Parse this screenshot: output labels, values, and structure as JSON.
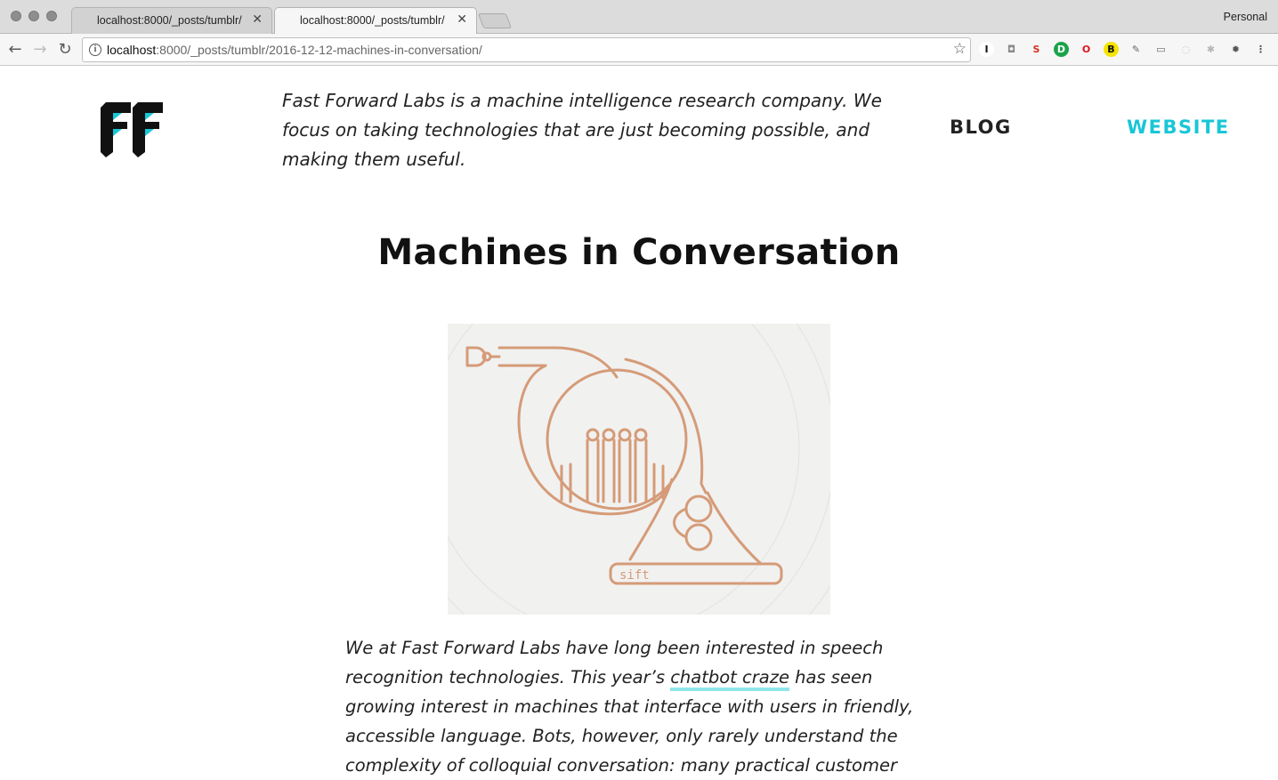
{
  "browser": {
    "tabs": [
      {
        "label": "localhost:8000/_posts/tumblr/",
        "active": false
      },
      {
        "label": "localhost:8000/_posts/tumblr/",
        "active": true
      }
    ],
    "profile": "Personal",
    "url_host": "localhost",
    "url_rest": ":8000/_posts/tumblr/2016-12-12-machines-in-conversation/",
    "extensions": [
      {
        "icon": "instapaper-icon",
        "glyph": "I",
        "color": "#111111",
        "bg": "#ffffff"
      },
      {
        "icon": "camera-icon",
        "glyph": "◘",
        "color": "#8a8a8a",
        "bg": "transparent"
      },
      {
        "icon": "s-extension-icon",
        "glyph": "S",
        "color": "#d93025",
        "bg": "transparent"
      },
      {
        "icon": "d-extension-icon",
        "glyph": "D",
        "color": "#ffffff",
        "bg": "#1aa34a"
      },
      {
        "icon": "opera-icon",
        "glyph": "O",
        "color": "#e0141e",
        "bg": "transparent"
      },
      {
        "icon": "b-extension-icon",
        "glyph": "B",
        "color": "#111111",
        "bg": "#f5e400"
      },
      {
        "icon": "pin-icon",
        "glyph": "✎",
        "color": "#666666",
        "bg": "transparent"
      },
      {
        "icon": "cast-icon",
        "glyph": "▭",
        "color": "#666666",
        "bg": "transparent"
      },
      {
        "icon": "circle-extension-icon",
        "glyph": "◌",
        "color": "#c4c4c4",
        "bg": "transparent"
      },
      {
        "icon": "gear-extension-icon",
        "glyph": "✱",
        "color": "#b5b5b5",
        "bg": "transparent"
      },
      {
        "icon": "bug-icon",
        "glyph": "✹",
        "color": "#555555",
        "bg": "transparent"
      },
      {
        "icon": "menu-icon",
        "glyph": "⋮",
        "color": "#555555",
        "bg": "transparent"
      }
    ]
  },
  "site": {
    "tagline": "Fast Forward Labs is a machine intelligence research company. We focus on taking technologies that are just becoming possible, and making them useful.",
    "nav": {
      "blog": "BLOG",
      "website": "WEBSITE"
    },
    "colors": {
      "accent": "#19c6d6",
      "illustration_stroke": "#d59b78",
      "link_underline": "#8fe6ea"
    }
  },
  "post": {
    "title": "Machines in Conversation",
    "illustration_label": "sift",
    "body_before_link": "We at Fast Forward Labs have long been interested in speech recognition technologies. This year’s ",
    "body_link": "chatbot craze",
    "body_after_link": " has seen growing interest in machines that interface with users in friendly, accessible language. Bots, however, only rarely understand the complexity of colloquial conversation: many practical customer"
  }
}
